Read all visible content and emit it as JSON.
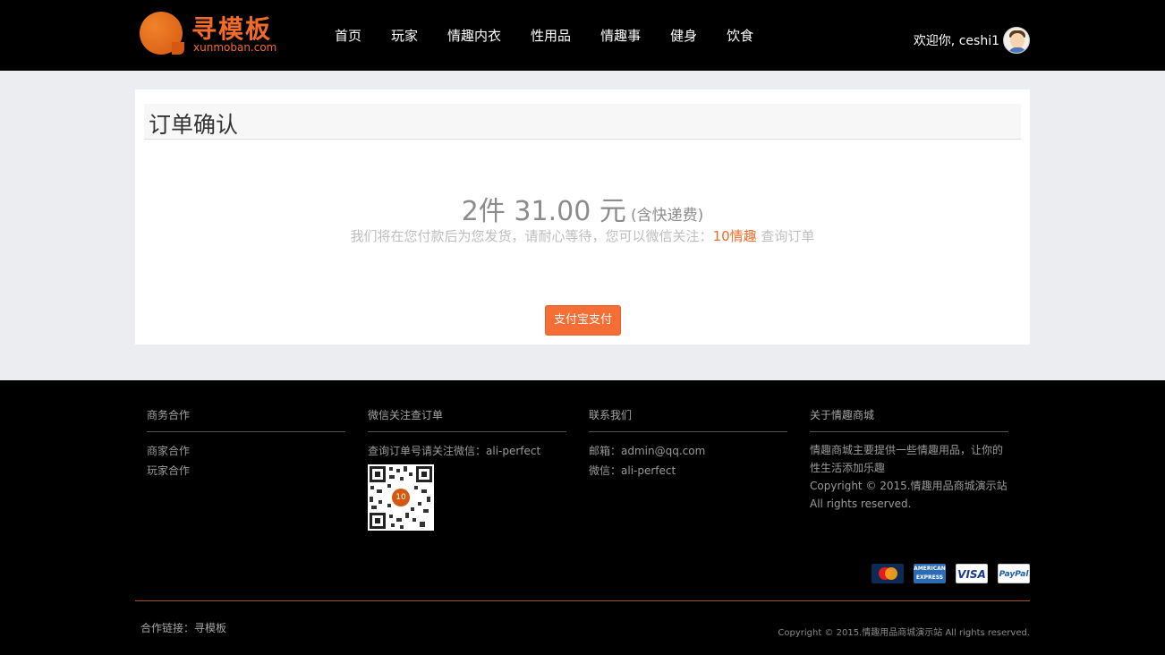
{
  "header": {
    "logo_cn": "寻模板",
    "logo_en": "xunmoban.com",
    "nav": [
      "首页",
      "玩家",
      "情趣内衣",
      "性用品",
      "情趣事",
      "健身",
      "饮食"
    ],
    "welcome": "欢迎你, ceshi1"
  },
  "order": {
    "title": "订单确认",
    "summary_main": "2件 31.00 元",
    "summary_note": "(含快递费)",
    "hint_prefix": "我们将在您付款后为您发货，请耐心等待，您可以微信关注：",
    "hint_accent": "10情趣",
    "hint_suffix": " 查询订单",
    "pay_button": "支付宝支付"
  },
  "footer": {
    "col1": {
      "title": "商务合作",
      "items": [
        "商家合作",
        "玩家合作"
      ]
    },
    "col2": {
      "title": "微信关注查订单",
      "text": "查询订单号请关注微信：ali-perfect",
      "qr_badge": "10"
    },
    "col3": {
      "title": "联系我们",
      "items": [
        "邮箱：admin@qq.com",
        "微信：ali-perfect"
      ]
    },
    "col4": {
      "title": "关于情趣商城",
      "desc": "情趣商城主要提供一些情趣用品，让你的性生活添加乐趣",
      "copyright": "Copyright © 2015.情趣用品商城演示站 All rights reserved."
    },
    "payment_cards": [
      "MasterCard",
      "AMERICAN EXPRESS",
      "VISA",
      "PayPal"
    ],
    "links": "合作链接：寻模板",
    "bottom_copyright": "Copyright © 2015.情趣用品商城演示站 All rights reserved."
  },
  "colors": {
    "accent": "#f46e36",
    "header_bg": "#000000",
    "page_bg": "#ecedf0"
  }
}
